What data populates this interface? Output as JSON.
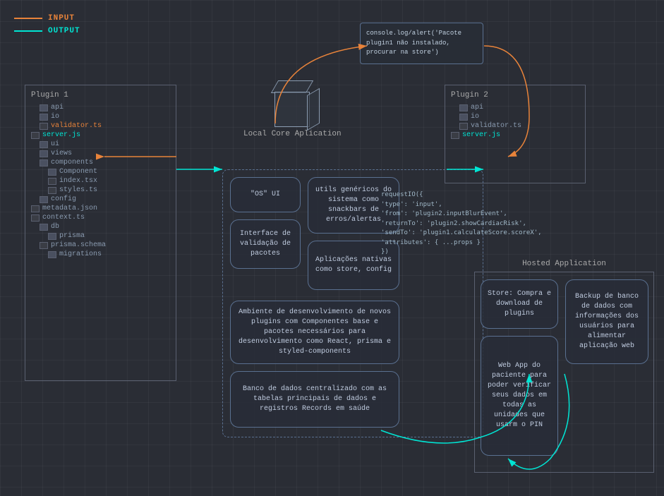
{
  "legend": {
    "input_label": "INPUT",
    "output_label": "OUTPUT"
  },
  "plugin1": {
    "title": "Plugin 1",
    "files": [
      {
        "type": "folder",
        "name": "api",
        "indent": 1
      },
      {
        "type": "folder",
        "name": "io",
        "indent": 1
      },
      {
        "type": "file",
        "name": "validator.ts",
        "highlight": "orange",
        "indent": 1
      },
      {
        "type": "file",
        "name": "server.js",
        "highlight": "cyan",
        "indent": 0
      },
      {
        "type": "folder",
        "name": "ui",
        "indent": 1
      },
      {
        "type": "folder",
        "name": "views",
        "indent": 1
      },
      {
        "type": "folder",
        "name": "components",
        "indent": 1
      },
      {
        "type": "folder",
        "name": "Component",
        "indent": 2
      },
      {
        "type": "file",
        "name": "index.tsx",
        "indent": 2
      },
      {
        "type": "file",
        "name": "styles.ts",
        "indent": 2
      },
      {
        "type": "folder",
        "name": "config",
        "indent": 1
      },
      {
        "type": "file",
        "name": "metadata.json",
        "indent": 0
      },
      {
        "type": "file",
        "name": "context.ts",
        "indent": 0
      },
      {
        "type": "folder",
        "name": "db",
        "indent": 1
      },
      {
        "type": "folder",
        "name": "prisma",
        "indent": 2
      },
      {
        "type": "file",
        "name": "prisma.schema",
        "indent": 1
      },
      {
        "type": "folder",
        "name": "migrations",
        "indent": 2
      }
    ]
  },
  "plugin2": {
    "title": "Plugin 2",
    "files": [
      {
        "type": "folder",
        "name": "api",
        "indent": 1
      },
      {
        "type": "folder",
        "name": "io",
        "indent": 1
      },
      {
        "type": "file",
        "name": "validator.ts",
        "indent": 1
      },
      {
        "type": "file",
        "name": "server.js",
        "highlight": "cyan",
        "indent": 0
      }
    ]
  },
  "cube": {
    "label": "Local Core Aplication"
  },
  "console_tooltip": {
    "text": "console.log/alert('Pacote\nplugin1 não instalado,\nprocurar na store')"
  },
  "os_ui_box": {
    "label": "\"OS\" UI"
  },
  "utils_box": {
    "text": "utils genéricos do sistema como snackbars de erros/alertas"
  },
  "validation_box": {
    "text": "Interface de validação de pacotes"
  },
  "native_apps_box": {
    "text": "Aplicações nativas como store, config"
  },
  "dev_env_box": {
    "text": "Ambiente de desenvolvimento de novos plugins com Componentes base e pacotes necessários para desenvolvimento como React, prisma e styled-components"
  },
  "db_box": {
    "text": "Banco de dados centralizado com as tabelas principais de dados e registros Records em saúde"
  },
  "hosted_app": {
    "title": "Hosted Application",
    "store_box": {
      "text": "Store: Compra e download de plugins"
    },
    "backup_box": {
      "text": "Backup de banco de dados com informações dos usuários para alimentar aplicação web"
    },
    "webapp_box": {
      "text": "Web App do paciente para poder verificar seus dados em todas as unidades que usarm o PIN"
    }
  },
  "request_io": {
    "text": "requestIO({\n'type': 'input',\n'from': 'plugin2.inputBlurEvent',\n'returnTo': 'plugin2.showCardiacRisk',\n'sendTo': 'plugin1.calculateScore.scoreX',\n'attributes': { ...props }\n})"
  }
}
